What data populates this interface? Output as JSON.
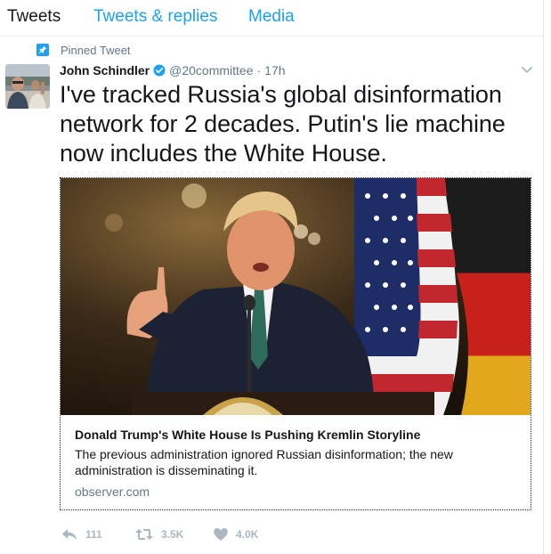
{
  "tabs": [
    {
      "label": "Tweets"
    },
    {
      "label": "Tweets & replies"
    },
    {
      "label": "Media"
    }
  ],
  "pinned": {
    "label": "Pinned Tweet"
  },
  "tweet": {
    "author_name": "John Schindler",
    "handle": "@20committee",
    "separator": "·",
    "time": "17h",
    "text": "I've tracked Russia's global disinformation network for 2 decades. Putin's lie machine now includes the White House."
  },
  "card": {
    "title": "Donald Trump's White House Is Pushing Kremlin Storyline",
    "description": "The previous administration ignored Russian disinformation; the new administration is disseminating it.",
    "domain": "observer.com"
  },
  "actions": {
    "reply_count": "111",
    "retweet_count": "3.5K",
    "like_count": "4.0K"
  },
  "colors": {
    "accent": "#1da1f2",
    "secondary_text": "#657786",
    "action_icon": "#aab8c2"
  },
  "icons": [
    "pin-icon",
    "verified-badge-icon",
    "chevron-down-icon",
    "reply-icon",
    "retweet-icon",
    "like-icon"
  ]
}
